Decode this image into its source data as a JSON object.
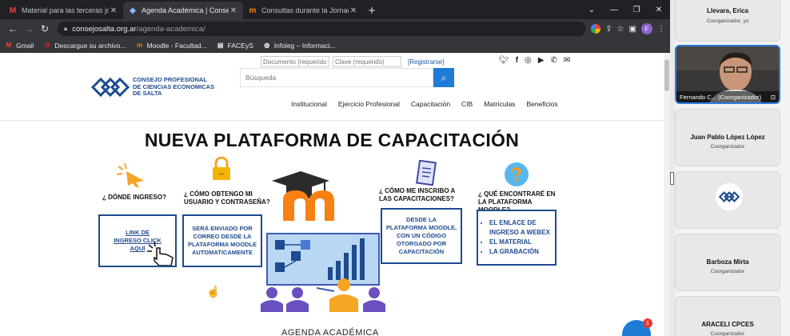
{
  "browser": {
    "tabs": [
      {
        "title": "Material para las terceras jornad",
        "icon": "gmail-icon",
        "active": false
      },
      {
        "title": "Agenda Académica | Consejo Prof",
        "icon": "cpces-icon",
        "active": true
      },
      {
        "title": "Consultas durante la Jornada",
        "icon": "moodle-icon",
        "active": false
      }
    ],
    "new_tab": "+",
    "url_host": "consejosalta.org.ar",
    "url_path": "/agenda-academica/",
    "profile_initial": "F",
    "bookmarks": [
      {
        "label": "Gmail",
        "icon": "gmail-icon"
      },
      {
        "label": "Descargue su archivo...",
        "icon": "opera-icon"
      },
      {
        "label": "Moodle - Facultad...",
        "icon": "moodle-icon"
      },
      {
        "label": "FACEyS",
        "icon": "doc-icon"
      },
      {
        "label": "Infoleg – Informaci...",
        "icon": "globe-icon"
      }
    ]
  },
  "site": {
    "doc_placeholder": "Documento (requerido)",
    "clave_placeholder": "Clave (requerido)",
    "register": "[Registrarse]",
    "logo_lines": [
      "CONSEJO PROFESIONAL",
      "DE CIENCIAS ECONOMICAS",
      "DE SALTA"
    ],
    "search_placeholder": "Búsqueda",
    "nav": [
      "Institucional",
      "Ejercicio Profesional",
      "Capacitación",
      "CIB",
      "Matrículas",
      "Beneficios"
    ],
    "headline": "NUEVA PLATAFORMA DE CAPACITACIÓN",
    "q1": "¿ DÓNDE INGRESO?",
    "q2": "¿ CÓMO OBTENGO MI USUARIO Y CONTRASEÑA?",
    "q3": "¿ CÓMO ME INSCRIBO A LAS CAPACITACIONES?",
    "q4": "¿ QUÉ ENCONTRARÉ EN LA PLATAFORMA MOODLE?",
    "box1": "LINK DE INGRESO CLICK AQUÍ",
    "box2": "SERÁ ENVIADO POR CORREO DESDE LA PLATAFORMA MOODLE AUTOMATICAMENTE",
    "box3": "DESDE LA PLATAFORMA MOODLE, CON UN CÓDIGO OTORGADO POR CAPACITACIÓN",
    "box4": [
      "EL ENLACE DE INGRESO A WEBEX",
      "EL MATERIAL",
      "LA GRABACIÓN"
    ],
    "subhead": "AGENDA ACADÉMICA",
    "chat_badge": "1"
  },
  "participants": [
    {
      "name": "Llevara, Erica",
      "role": "Coorganizador, yo"
    },
    {
      "name": "Fernando C... (Coorganizador)",
      "role": "",
      "video": true
    },
    {
      "name": "Juan Pablo López López",
      "role": "Coorganizador"
    },
    {
      "name": "",
      "role": "",
      "logo": true
    },
    {
      "name": "Barboza Mirta",
      "role": "Coorganizador"
    },
    {
      "name": "ARACELI CPCES",
      "role": "Coorganizador"
    }
  ],
  "colors": {
    "brand_blue": "#1e4b8f",
    "accent_blue": "#1e7bd6",
    "moodle_orange": "#f98012"
  }
}
